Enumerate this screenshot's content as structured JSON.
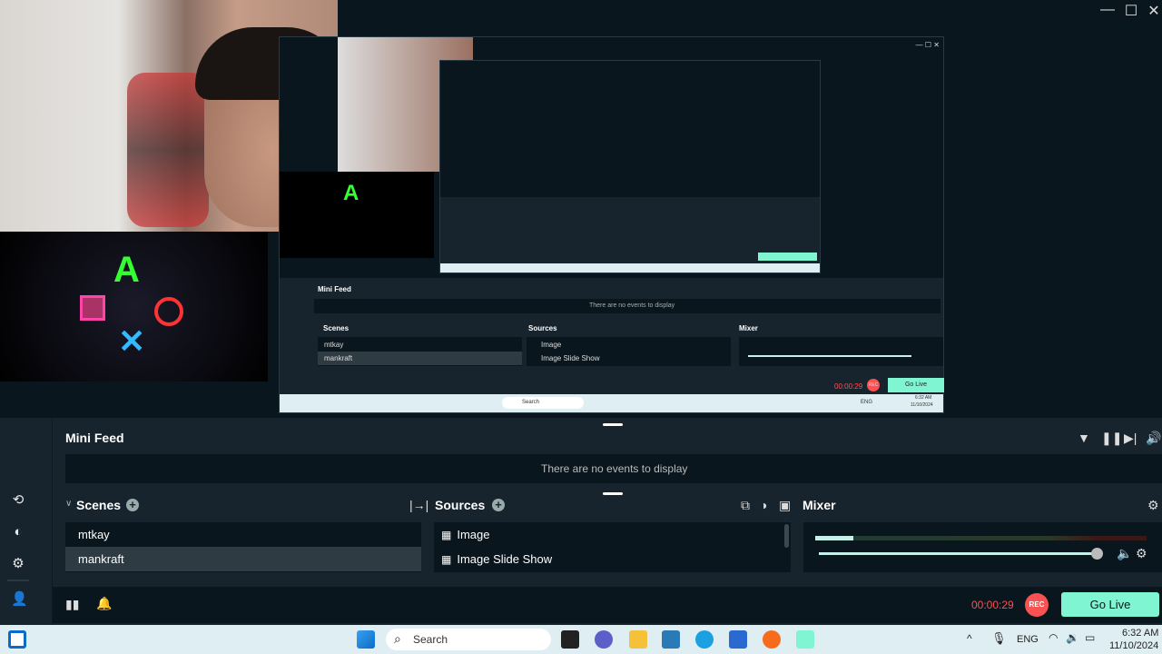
{
  "window": {
    "minimize": "—",
    "maximize": "☐",
    "close": "✕"
  },
  "mini_feed": {
    "title": "Mini Feed",
    "empty": "There are no events to display"
  },
  "scenes": {
    "title": "Scenes",
    "items": [
      {
        "label": "mtkay",
        "selected": false
      },
      {
        "label": "mankraft",
        "selected": true
      }
    ]
  },
  "sources": {
    "title": "Sources",
    "items": [
      "Image",
      "Image Slide Show"
    ]
  },
  "mixer": {
    "title": "Mixer",
    "volume": 0.97
  },
  "footer": {
    "timer": "00:00:29",
    "rec": "REC",
    "go_live": "Go Live"
  },
  "taskbar": {
    "search": "Search",
    "lang": "ENG",
    "time": "6:32 AM",
    "date": "11/10/2024"
  },
  "nested": {
    "mini_feed": "Mini Feed",
    "empty": "There are no events to display",
    "scenes": "Scenes",
    "sources": "Sources",
    "mixer": "Mixer",
    "scene_items": [
      "mtkay",
      "mankraft"
    ],
    "source_items": [
      "Image",
      "Image Slide Show"
    ],
    "timer": "00:00:29",
    "rec": "REC",
    "go_live": "Go Live",
    "search": "Search",
    "lang": "ENG",
    "time": "6:32 AM",
    "date": "11/10/2024"
  },
  "colors": {
    "accent": "#80f5d2",
    "rec": "#f85252",
    "timer": "#f85252"
  }
}
